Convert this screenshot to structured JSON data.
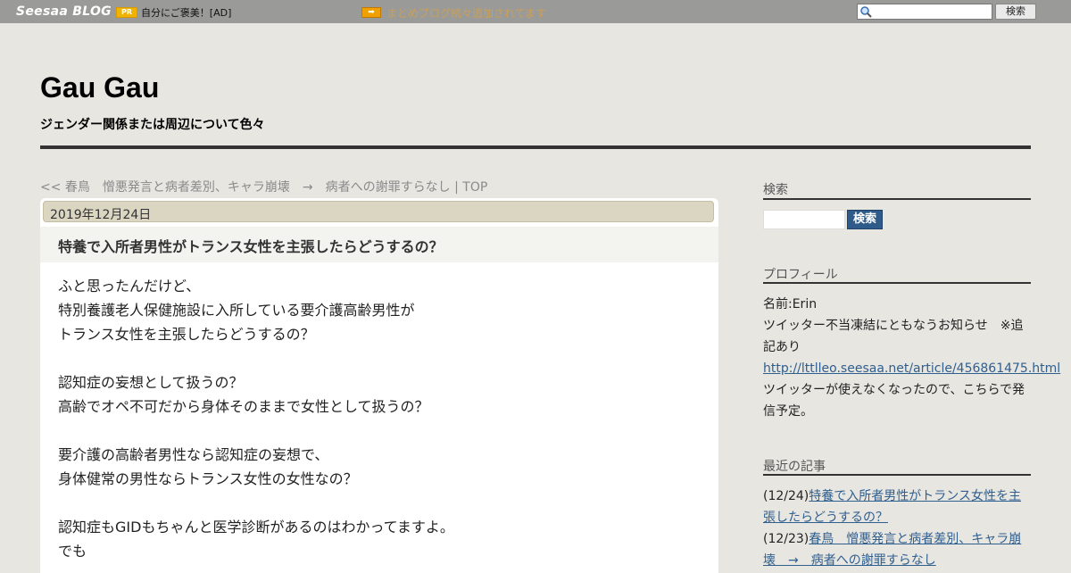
{
  "topbar": {
    "logo": "Seesaa BLOG",
    "pr_badge": "PR",
    "pr_text": "自分にご褒美！[AD]",
    "arrow_badge": "➡",
    "notice": "まとめブログ続々追加されてます",
    "search_placeholder": "",
    "search_button": "検索"
  },
  "header": {
    "title": "Gau Gau",
    "description": "ジェンダー関係または周辺について色々"
  },
  "post_nav": {
    "prev_prefix": "<<",
    "prev_label": "春鳥　憎悪発言と病者差別、キャラ崩壊　→　病者への謝罪すらなし",
    "separator": "|",
    "top_label": "TOP"
  },
  "article": {
    "date": "2019年12月24日",
    "title": "特養で入所者男性がトランス女性を主張したらどうするの？",
    "body_lines": [
      "ふと思ったんだけど、",
      "特別養護老人保健施設に入所している要介護高齢男性が",
      "トランス女性を主張したらどうするの？",
      "",
      "認知症の妄想として扱うの？",
      "高齢でオペ不可だから身体そのままで女性として扱うの？",
      "",
      "要介護の高齢者男性なら認知症の妄想で、",
      "身体健常の男性ならトランス女性の女性なの？",
      "",
      "認知症もGIDもちゃんと医学診断があるのはわかってますよ。",
      "でも"
    ]
  },
  "sidebar": {
    "search": {
      "heading": "検索",
      "input_value": "",
      "button": "検索"
    },
    "profile": {
      "heading": "プロフィール",
      "name": "名前:Erin",
      "notice": "ツイッター不当凍結にともなうお知らせ　※追記あり",
      "link": "http://lttlleo.seesaa.net/article/456861475.html",
      "note": "ツイッターが使えなくなったので、こちらで発信予定。"
    },
    "recent": {
      "heading": "最近の記事",
      "items": [
        {
          "date": "(12/24)",
          "title": "特養で入所者男性がトランス女性を主張したらどうするの？"
        },
        {
          "date": "(12/23)",
          "title": "春鳥　憎悪発言と病者差別、キャラ崩壊　→　病者への謝罪すらなし"
        }
      ]
    }
  }
}
